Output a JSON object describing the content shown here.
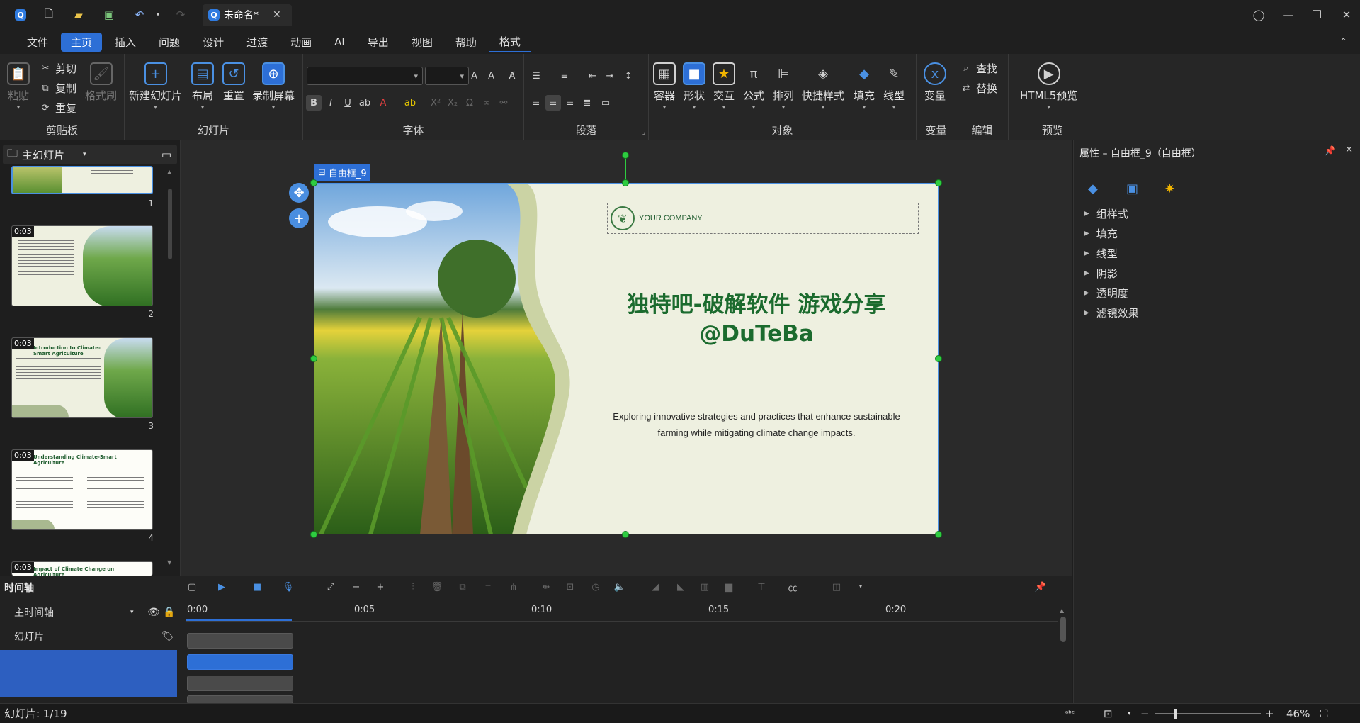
{
  "app": {
    "doc_title": "未命名*",
    "logo_letter": "Q"
  },
  "menu": {
    "items": [
      "文件",
      "主页",
      "插入",
      "问题",
      "设计",
      "过渡",
      "动画",
      "AI",
      "导出",
      "视图",
      "帮助",
      "格式"
    ],
    "active": "主页"
  },
  "ribbon": {
    "clipboard": {
      "paste": "粘贴",
      "cut": "剪切",
      "copy": "复制",
      "repeat": "重复",
      "format_painter": "格式刷",
      "label": "剪贴板"
    },
    "slides": {
      "new_slide": "新建幻灯片",
      "layout": "布局",
      "reset": "重置",
      "record": "录制屏幕",
      "label": "幻灯片"
    },
    "font": {
      "label": "字体"
    },
    "paragraph": {
      "label": "段落"
    },
    "objects": {
      "container": "容器",
      "shape": "形状",
      "interact": "交互",
      "formula": "公式",
      "arrange": "排列",
      "quick_style": "快捷样式",
      "fill": "填充",
      "line": "线型",
      "label": "对象"
    },
    "variables": {
      "variable": "变量",
      "label": "变量"
    },
    "edit": {
      "find": "查找",
      "replace": "替换",
      "label": "编辑"
    },
    "preview": {
      "html5": "HTML5预览",
      "label": "预览"
    }
  },
  "slide_panel": {
    "header": "主幻灯片",
    "thumbs": [
      {
        "num": "1",
        "time": ""
      },
      {
        "num": "2",
        "time": "0:03"
      },
      {
        "num": "3",
        "time": "0:03",
        "title": "Introduction to Climate-Smart Agriculture"
      },
      {
        "num": "4",
        "time": "0:03",
        "title": "Understanding Climate-Smart Agriculture"
      },
      {
        "num": "",
        "time": "0:03",
        "title": "Impact of Climate Change on Agriculture"
      }
    ]
  },
  "canvas": {
    "selection_tag": "自由框_9",
    "company": "YOUR COMPANY",
    "title_line1": "独特吧-破解软件 游戏分享",
    "title_line2": "@DuTeBa",
    "subtitle_line1": "Exploring innovative strategies and practices that enhance sustainable",
    "subtitle_line2": "farming while mitigating climate change impacts."
  },
  "properties": {
    "title": "属性 – 自由框_9（自由框）",
    "sections": [
      "组样式",
      "填充",
      "线型",
      "阴影",
      "透明度",
      "滤镜效果"
    ]
  },
  "timeline": {
    "label": "时间轴",
    "main_track": "主时间轴",
    "slide_track": "幻灯片",
    "ticks": [
      "0:00",
      "0:05",
      "0:10",
      "0:15",
      "0:20"
    ]
  },
  "status": {
    "slide_info": "幻灯片: 1/19",
    "zoom": "46%"
  },
  "colors": {
    "accent": "#2d6fd6",
    "slide_title": "#1b6b2e",
    "handle": "#2ecc40"
  }
}
